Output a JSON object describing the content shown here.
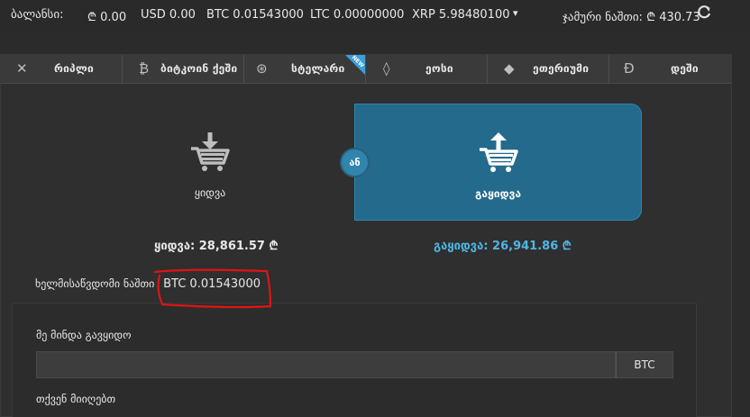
{
  "topbar": {
    "balance_label": "ბალანსი:",
    "balances": [
      {
        "text": "₾ 0.00"
      },
      {
        "text": "USD 0.00"
      },
      {
        "text": "BTC 0.01543000"
      },
      {
        "text": "LTC 0.00000000"
      },
      {
        "text": "XRP 5.98480100"
      }
    ],
    "caret": "▾",
    "total_label": "ჯამური ნაშთი:",
    "total_value": "₾ 430.73",
    "refresh_icon": "refresh-icon"
  },
  "tabs": [
    {
      "label": "რიპლი",
      "icon": "ripple-icon",
      "glyph": "✕"
    },
    {
      "label": "ბიტკოინ ქეში",
      "icon": "bitcoin-cash-icon",
      "glyph": "₿"
    },
    {
      "label": "სტელარი",
      "icon": "stellar-icon",
      "glyph": "⊛",
      "badge": "NEW"
    },
    {
      "label": "ეოსი",
      "icon": "eos-icon",
      "glyph": "◊"
    },
    {
      "label": "ეთერიუმი",
      "icon": "ethereum-icon",
      "glyph": "◆"
    },
    {
      "label": "დეში",
      "icon": "dash-icon",
      "glyph": "Ð"
    }
  ],
  "trade": {
    "buy_label": "ყიდვა",
    "sell_label": "გაყიდვა",
    "or_label": "ან",
    "buy_price": "ყიდვა: 28,861.57 ₾",
    "sell_price": "გაყიდვა: 26,941.86 ₾"
  },
  "available": {
    "label": "ხელმისაწვდომი ნაშთი",
    "value": "BTC 0.01543000"
  },
  "form": {
    "want_sell_label": "მე მინდა გავყიდო",
    "amount_value": "",
    "amount_placeholder": "",
    "currency": "BTC",
    "you_get_label": "თქვენ მიიღებთ"
  },
  "colors": {
    "accent": "#236a8c",
    "accent_light": "#4fb6e6",
    "annotation": "#e01414"
  }
}
